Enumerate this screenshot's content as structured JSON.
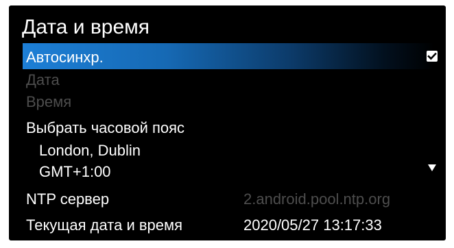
{
  "title": "Дата и время",
  "autosync": {
    "label": "Автосинхр.",
    "checked": true,
    "icon": "checkbox-checked-icon",
    "highlight_color": "#1d7fd6"
  },
  "date": {
    "label": "Дата",
    "enabled": false
  },
  "time": {
    "label": "Время",
    "enabled": false
  },
  "timezone": {
    "label": "Выбрать часовой пояс",
    "city": "London, Dublin",
    "offset": "GMT+1:00",
    "icon": "dropdown-arrow-icon"
  },
  "ntp": {
    "label": "NTP сервер",
    "value": "2.android.pool.ntp.org",
    "enabled": false
  },
  "current": {
    "label": "Текущая дата и время",
    "value": "2020/05/27 13:17:33"
  },
  "colors": {
    "background": "#000000",
    "text": "#ffffff",
    "disabled_text": "#4d4d4d"
  }
}
